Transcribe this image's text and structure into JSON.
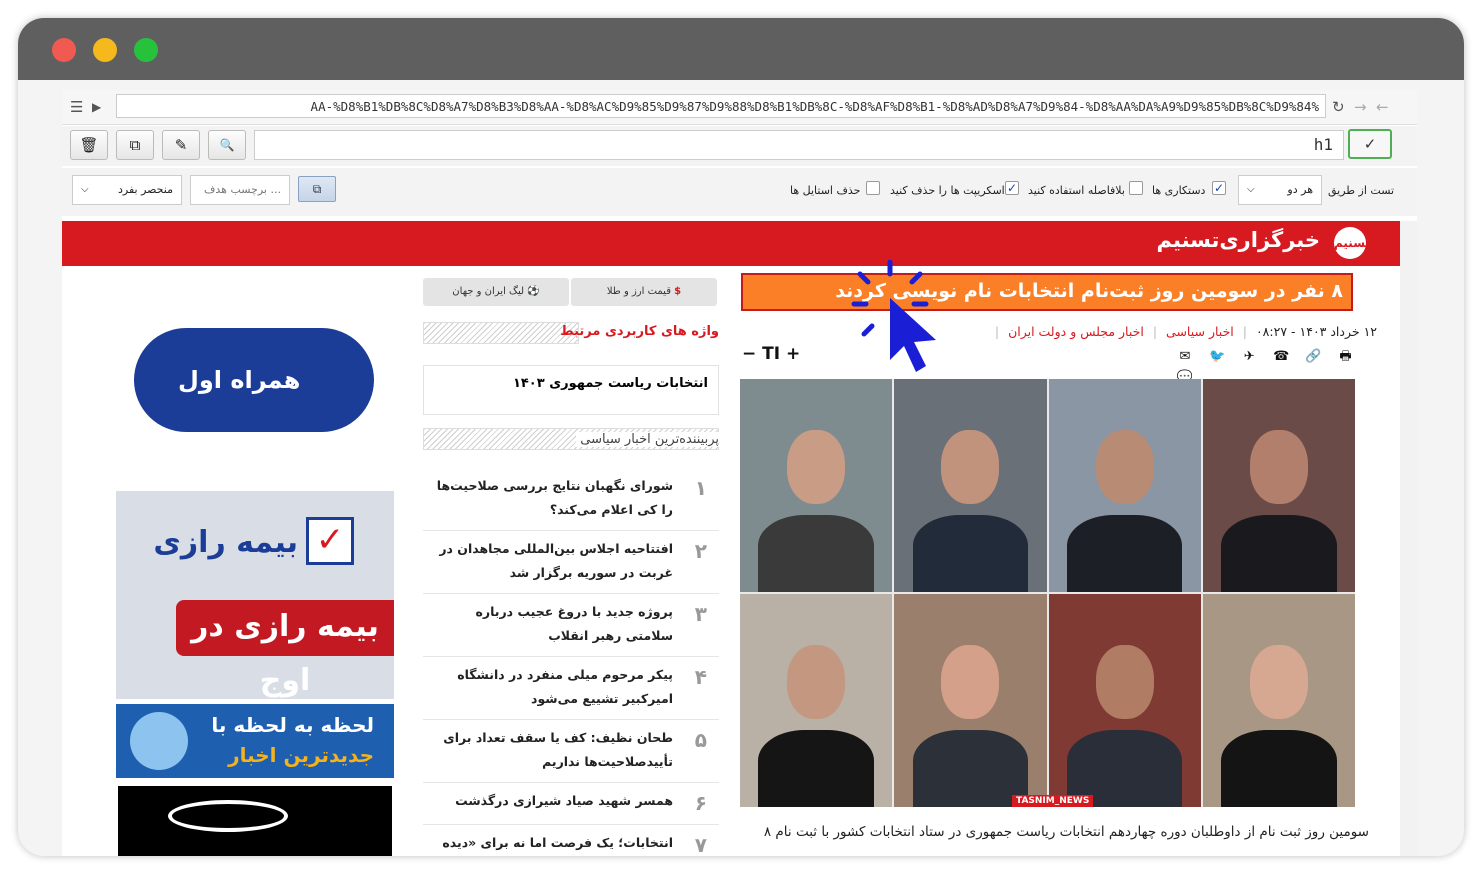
{
  "window": {
    "traffic_lights": [
      "close",
      "minimize",
      "maximize"
    ]
  },
  "address_bar": {
    "url": "%AA-%D8%B1%DB%8C%D8%A7%D8%B3%D8%AA-%D8%AC%D9%85%D9%87%D9%88%D8%B1%DB%8C-%D8%AF%D8%B1-%D8%AD%D8%A7%D9%84-%D8%AA%DA%A9%D9%85%DB%8C%D9%84",
    "icons": {
      "menu": "☰",
      "play": "▶",
      "reload": "↻",
      "back": "←",
      "forward": "→"
    }
  },
  "toolbar": {
    "selector_value": "h1",
    "confirm_icon": "✓",
    "delete_icon": "🗑",
    "copy_icon": "⧉",
    "erase_icon": "✎",
    "search_icon": "🔍"
  },
  "options": {
    "test_via_label": "تست از طریق",
    "test_via_value": "هر دو",
    "manipulations_label": "دستکاری ها",
    "manipulations_checked": true,
    "use_immediately_label": "بلافاصله استفاده کنید",
    "use_immediately_checked": false,
    "remove_scripts_label": "اسکریپت ها را حذف کنید",
    "remove_scripts_checked": true,
    "remove_styles_label": "حذف استایل ها",
    "remove_styles_checked": false,
    "target_tag_placeholder": "برچسب هدف ...",
    "unique_label": "منحصر بفرد",
    "open_icon": "⧉"
  },
  "site": {
    "logo_text": "خبرگزاری‌تسنیم",
    "logo_mark": "تسنیم",
    "headline": "۸ نفر در سومین روز ثبت‌نام انتخابات نام نویسی کردند",
    "date": "۱۲ خرداد ۱۴۰۳ - ۰۸:۲۷",
    "category1": "اخبار سیاسی",
    "category2": "اخبار مجلس و دولت ایران",
    "font_controls": "− TI +",
    "share_icons": [
      "✉",
      "🐦",
      "✈",
      "☎",
      "🔗",
      "🖶",
      "💬"
    ],
    "watermark": "TASNIM_NEWS",
    "caption": "سومین روز ثبت نام از داوطلبان دوره چهاردهم انتخابات ریاست جمهوری در ستاد انتخابات کشور با ثبت نام ۸"
  },
  "sidebar": {
    "tab_currency": "قیمت ارز و طلا",
    "tab_league": "لیگ ایران و جهان",
    "keywords_title": "واژه های کاربردی مرتبط",
    "keyword1": "انتخابات ریاست جمهوری ۱۴۰۳",
    "most_viewed_title": "پربیننده‌ترین اخبار سیاسی",
    "most_viewed": [
      {
        "num": "۱",
        "text": "شورای نگهبان نتایج بررسی صلاحیت‌ها را کی اعلام می‌کند؟"
      },
      {
        "num": "۲",
        "text": "افتتاحیه اجلاس بین‌المللی مجاهدان در غربت در سوریه برگزار شد"
      },
      {
        "num": "۳",
        "text": "پروژه جدید با دروغ عجیب درباره سلامتی رهبر انقلاب"
      },
      {
        "num": "۴",
        "text": "پیکر مرحوم میلی منفرد در دانشگاه امیرکبیر تشییع می‌شود"
      },
      {
        "num": "۵",
        "text": "طحان نظیف: کف یا سقف تعداد برای تأییدصلاحیت‌ها نداریم"
      },
      {
        "num": "۶",
        "text": "همسر شهید صیاد شیرازی درگذشت"
      },
      {
        "num": "۷",
        "text": "انتخابات؛ یک فرصت اما نه برای «دیده"
      }
    ]
  },
  "ads": {
    "hamrah": "همراه اول",
    "bime_brand": "بیمه رازی",
    "bime_slogan": "بیمه رازی در اوج",
    "news_line1": "لحظه به لحظه با",
    "news_line2": "جدیدترین اخبار"
  },
  "colors": {
    "brand_red": "#d71920",
    "headline_orange": "#fb7f26",
    "cursor_blue": "#1a1fd6"
  }
}
